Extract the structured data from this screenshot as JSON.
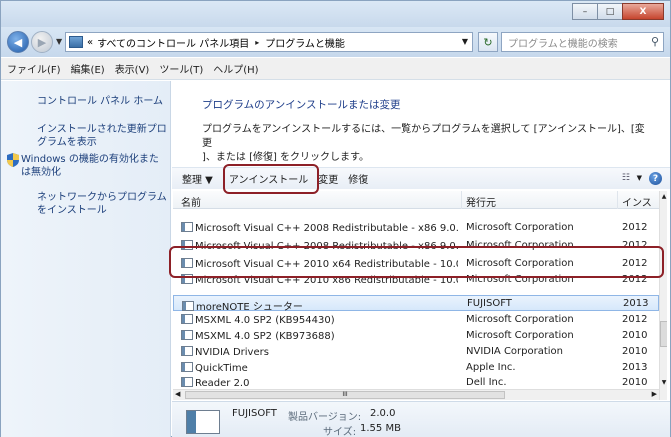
{
  "window": {
    "minimize_glyph": "–",
    "maximize_glyph": "□",
    "close_glyph": "X"
  },
  "address": {
    "prefix": "«",
    "segments": [
      "すべてのコントロール パネル項目",
      "プログラムと機能"
    ],
    "separator": "▸",
    "search_placeholder": "プログラムと機能の検索"
  },
  "menu": [
    "ファイル(F)",
    "編集(E)",
    "表示(V)",
    "ツール(T)",
    "ヘルプ(H)"
  ],
  "sidebar": {
    "home": "コントロール パネル ホーム",
    "updates": [
      "インストールされた更新プロ",
      "グラムを表示"
    ],
    "features": [
      "Windows の機能の有効化また",
      "は無効化"
    ],
    "network": [
      "ネットワークからプログラム",
      "をインストール"
    ]
  },
  "main": {
    "heading": "プログラムのアンインストールまたは変更",
    "description": [
      "プログラムをアンインストールするには、一覧からプログラムを選択して [アンインストール]、[変更",
      "]、または [修復] をクリックします。"
    ]
  },
  "toolbar": {
    "organize": "整理 ▼",
    "uninstall": "アンインストール",
    "change": "変更",
    "repair": "修復",
    "help": "?"
  },
  "table": {
    "headers": [
      "名前",
      "発行元",
      "インス"
    ],
    "rows": [
      {
        "name": "Microsoft Visual C++ 2008 Redistributable - x86 9.0.3...",
        "publisher": "Microsoft Corporation",
        "date": "2012"
      },
      {
        "name": "Microsoft Visual C++ 2008 Redistributable - x86 9.0.3...",
        "publisher": "Microsoft Corporation",
        "date": "2012"
      },
      {
        "name": "Microsoft Visual C++ 2010  x64 Redistributable - 10.0....",
        "publisher": "Microsoft Corporation",
        "date": "2012"
      },
      {
        "name": "Microsoft Visual C++ 2010  x86 Redistributable - 10.0....",
        "publisher": "Microsoft Corporation",
        "date": "2012"
      },
      {
        "name": "moreNOTE シューター",
        "publisher": "FUJISOFT",
        "date": "2013"
      },
      {
        "name": "MSXML 4.0 SP2 (KB954430)",
        "publisher": "Microsoft Corporation",
        "date": "2012"
      },
      {
        "name": "MSXML 4.0 SP2 (KB973688)",
        "publisher": "Microsoft Corporation",
        "date": "2010"
      },
      {
        "name": "NVIDIA Drivers",
        "publisher": "NVIDIA Corporation",
        "date": "2010"
      },
      {
        "name": "QuickTime",
        "publisher": "Apple Inc.",
        "date": "2013"
      },
      {
        "name": "Reader 2.0",
        "publisher": "Dell Inc.",
        "date": "2010"
      }
    ],
    "hscroll_grip": "III"
  },
  "details": {
    "publisher": "FUJISOFT",
    "version_label": "製品バージョン:",
    "version": "2.0.0",
    "size_label": "サイズ:",
    "size": "1.55 MB"
  },
  "colors": {
    "highlight": "#8d2027",
    "link": "#1b3e7a",
    "heading": "#1f3e8a"
  }
}
